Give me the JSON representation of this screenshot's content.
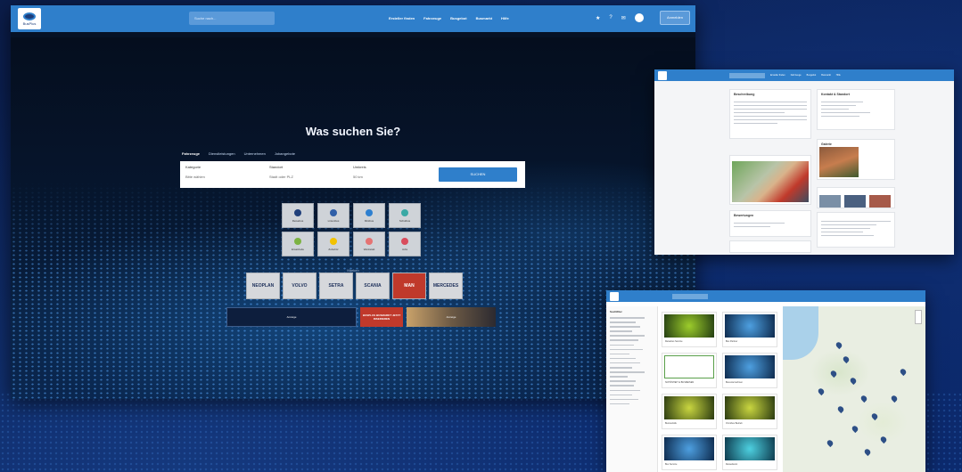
{
  "main": {
    "logo_text": "BusPlus",
    "search_placeholder": "Suche nach...",
    "nav_links": [
      "Ersteller finden",
      "Fahrzeuge",
      "Busgebot",
      "Busmarkt",
      "Hilfe"
    ],
    "nav_icons": [
      "star-icon",
      "help-icon",
      "chat-icon",
      "avatar"
    ],
    "nav_login": "Anmelden",
    "headline": "Was suchen Sie?",
    "tabs": [
      "Fahrzeuge",
      "Dienstleistungen",
      "Unternehmen",
      "Jobangebote"
    ],
    "form": {
      "category_label": "Kategorie",
      "category_value": "Bitte wählen",
      "location_label": "Standort",
      "location_value": "Stadt oder PLZ",
      "radius_label": "Umkreis",
      "radius_value": "50 km",
      "search_button": "SUCHEN"
    },
    "categories": [
      {
        "label": "Reisebus",
        "color": "#1f3f7a"
      },
      {
        "label": "Linienbus",
        "color": "#2f5fa8"
      },
      {
        "label": "Minibus",
        "color": "#2d7fd0"
      },
      {
        "label": "Schulbus",
        "color": "#3aa9a5"
      },
      {
        "label": "Ersatzteile",
        "color": "#7cb342"
      },
      {
        "label": "Zubehör",
        "color": "#f2c200"
      },
      {
        "label": "Werkstatt",
        "color": "#e57373"
      },
      {
        "label": "Jobs",
        "color": "#d94c5c"
      }
    ],
    "brands_caption": "Marken",
    "brands": [
      "NEOPLAN",
      "VOLVO",
      "SETRA",
      "SCANIA",
      "MAN",
      "MERCEDES"
    ],
    "ads": [
      "Anzeige",
      "BUSPLUS BUSMARKT JETZT INSERIEREN",
      "Anzeige"
    ]
  },
  "rt": {
    "links": [
      "Ersteller finden",
      "Fahrzeuge",
      "Busgebot",
      "Busmarkt",
      "Hilfe"
    ],
    "card_titles": [
      "Beschreibung",
      "Kontakt & Standort",
      "Galerie",
      "Bewertungen"
    ]
  },
  "rb": {
    "filter_title": "Suchfilter",
    "results": [
      "Reisebus Service",
      "Bus Partner",
      "SCHÖNHEIT & BUSREISEN",
      "Busunternehmen",
      "Bustouristik",
      "Omnibus Betrieb",
      "Bus Service",
      "Reisedienst"
    ],
    "map_label": "Karte"
  }
}
